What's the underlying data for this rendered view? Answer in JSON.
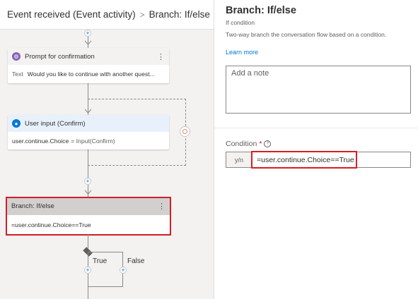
{
  "breadcrumb": {
    "trigger": "Event received (Event activity)",
    "separator": ">",
    "current": "Branch: If/else"
  },
  "nodes": {
    "prompt": {
      "title": "Prompt for confirmation",
      "body_type": "Text",
      "body_text": "Would you like to continue with another quest..."
    },
    "user_input": {
      "title": "User input (Confirm)",
      "property": "user.continue.Choice",
      "assign": "= Input(Confirm)"
    },
    "branch": {
      "title": "Branch: If/else",
      "condition": "=user.continue.Choice==True"
    },
    "true_label": "True",
    "false_label": "False"
  },
  "panel": {
    "title": "Branch: If/else",
    "subtitle": "If condition",
    "description": "Two-way branch the conversation flow based on a condition.",
    "learn_more": "Learn more",
    "note_placeholder": "Add a note",
    "condition_label": "Condition",
    "required_marker": "*",
    "condition_prefix": "y/n",
    "condition_value": "=user.continue.Choice==True"
  },
  "colors": {
    "highlight": "#d21f26",
    "link": "#0078d4",
    "prompt_icon": "#8764b8",
    "input_icon": "#0078d4"
  }
}
